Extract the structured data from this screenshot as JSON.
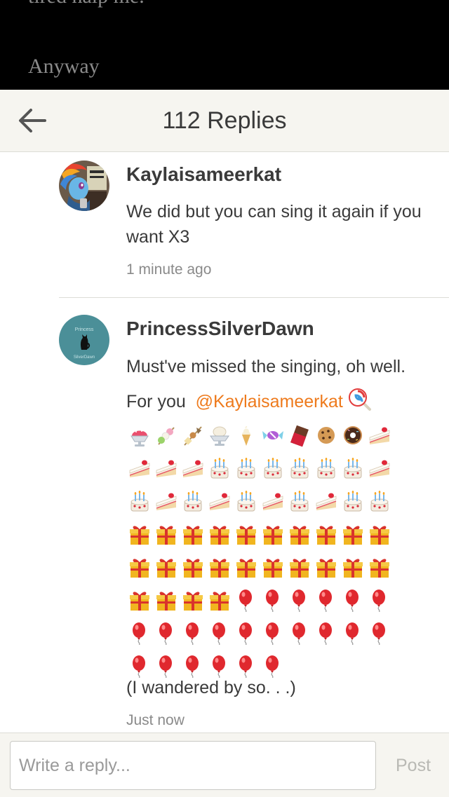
{
  "background_article": {
    "line1": "tired halp me.",
    "line2": "Anyway"
  },
  "header": {
    "back_icon": "arrow-left-icon",
    "title": "112 Replies"
  },
  "comments": [
    {
      "username": "Kaylaisameerkat",
      "avatar": "pony-avatar-image",
      "text": "We did but you can sing it again if you want X3",
      "timestamp": "1 minute ago"
    },
    {
      "username": "PrincessSilverDawn",
      "avatar": "black-cat-teal-circle-avatar",
      "avatar_text_top": "Princess",
      "avatar_text_bottom": "SilverDawn",
      "text": "Must've missed the singing, oh well.",
      "for_you_prefix": "For you",
      "mention": "@Kaylaisameerkat",
      "emoji_rows": [
        [
          "shaved-ice",
          "dango",
          "oden",
          "ice-cream",
          "soft-ice-cream",
          "candy",
          "chocolate-bar",
          "cookie",
          "doughnut",
          "shortcake"
        ],
        [
          "shortcake",
          "shortcake",
          "shortcake",
          "birthday-cake",
          "birthday-cake",
          "birthday-cake",
          "birthday-cake",
          "birthday-cake",
          "birthday-cake",
          "shortcake"
        ],
        [
          "birthday-cake",
          "shortcake",
          "birthday-cake",
          "shortcake",
          "birthday-cake",
          "shortcake",
          "birthday-cake",
          "shortcake",
          "birthday-cake",
          "birthday-cake"
        ],
        [
          "gift",
          "gift",
          "gift",
          "gift",
          "gift",
          "gift",
          "gift",
          "gift",
          "gift",
          "gift"
        ],
        [
          "gift",
          "gift",
          "gift",
          "gift",
          "gift",
          "gift",
          "gift",
          "gift",
          "gift",
          "gift"
        ],
        [
          "gift",
          "gift",
          "gift",
          "gift",
          "balloon",
          "balloon",
          "balloon",
          "balloon",
          "balloon",
          "balloon"
        ],
        [
          "balloon",
          "balloon",
          "balloon",
          "balloon",
          "balloon",
          "balloon",
          "balloon",
          "balloon",
          "balloon",
          "balloon"
        ],
        [
          "balloon",
          "balloon",
          "balloon",
          "balloon",
          "balloon",
          "balloon"
        ]
      ],
      "closing": "(I wandered by so. . .)",
      "timestamp": "Just now"
    }
  ],
  "composer": {
    "placeholder": "Write a reply...",
    "post_label": "Post"
  },
  "colors": {
    "mention": "#ee7a1c",
    "header_bg": "#f6f5f0",
    "text": "#3a3a3a",
    "muted": "#8a8a8a"
  }
}
